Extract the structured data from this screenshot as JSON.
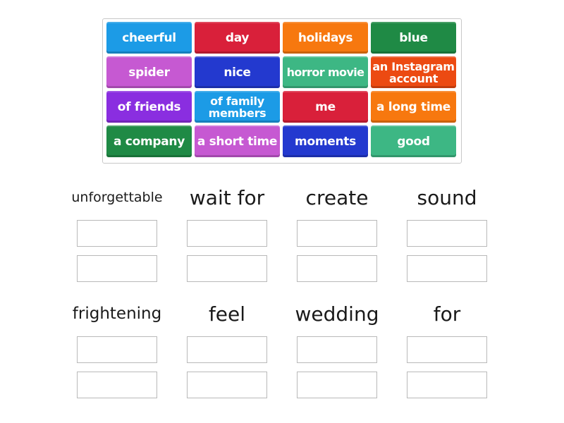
{
  "tiles": [
    {
      "label": "cheerful",
      "color": "#1c9be6"
    },
    {
      "label": "day",
      "color": "#d9203a"
    },
    {
      "label": "holidays",
      "color": "#f7780f"
    },
    {
      "label": "blue",
      "color": "#1f8a45"
    },
    {
      "label": "spider",
      "color": "#c659d2"
    },
    {
      "label": "nice",
      "color": "#2339cf"
    },
    {
      "label": "horror movie",
      "color": "#3db784"
    },
    {
      "label": "an Instagram account",
      "color": "#ec4a12"
    },
    {
      "label": "of friends",
      "color": "#8a2ee0"
    },
    {
      "label": "of family members",
      "color": "#1c9be6"
    },
    {
      "label": "me",
      "color": "#d9203a"
    },
    {
      "label": "a long time",
      "color": "#f7780f"
    },
    {
      "label": "a company",
      "color": "#1f8a45"
    },
    {
      "label": "a short time",
      "color": "#c659d2"
    },
    {
      "label": "moments",
      "color": "#2339cf"
    },
    {
      "label": "good",
      "color": "#3db784"
    }
  ],
  "groups": [
    {
      "title": "unforgettable",
      "slots": [
        "",
        ""
      ]
    },
    {
      "title": "wait for",
      "slots": [
        "",
        ""
      ]
    },
    {
      "title": "create",
      "slots": [
        "",
        ""
      ]
    },
    {
      "title": "sound",
      "slots": [
        "",
        ""
      ]
    },
    {
      "title": "frightening",
      "slots": [
        "",
        ""
      ]
    },
    {
      "title": "feel",
      "slots": [
        "",
        ""
      ]
    },
    {
      "title": "wedding",
      "slots": [
        "",
        ""
      ]
    },
    {
      "title": "for",
      "slots": [
        "",
        ""
      ]
    }
  ]
}
